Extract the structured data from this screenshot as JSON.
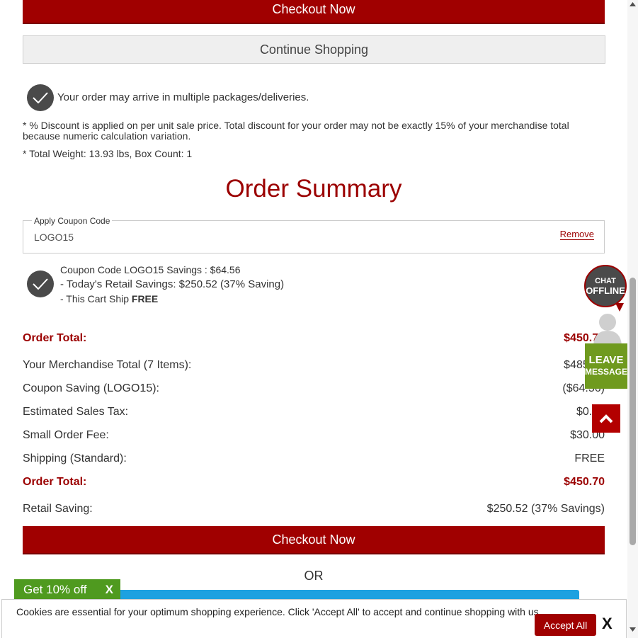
{
  "buttons": {
    "checkout_top": "Checkout Now",
    "continue_shopping": "Continue Shopping",
    "checkout_bottom": "Checkout Now"
  },
  "notices": {
    "packages": "Your order may arrive in multiple packages/deliveries.",
    "discount_note": "* % Discount is applied on per unit sale price. Total discount for your order may not be exactly 15% of your merchandise total because numeric calculation variation.",
    "weight_note": "* Total Weight: 13.93 lbs, Box Count: 1"
  },
  "order_summary": {
    "title": "Order Summary",
    "coupon": {
      "legend": "Apply Coupon Code",
      "value": "LOGO15",
      "remove_label": "Remove"
    },
    "savings": {
      "coupon_line": "Coupon Code LOGO15 Savings : $64.56",
      "retail_line": "- Today's Retail Savings:  $250.52 (37% Saving)",
      "ship_prefix": "- This Cart Ship ",
      "ship_value": "FREE"
    },
    "lines": [
      {
        "label": "Order Total:",
        "value": "$450.70",
        "total": true
      },
      {
        "label": "Your Merchandise Total (7 Items):",
        "value": "$485.26",
        "total": false
      },
      {
        "label": "Coupon Saving (LOGO15):",
        "value": "($64.56)",
        "total": false
      },
      {
        "label": "Estimated Sales Tax:",
        "value": "$0.00",
        "total": false
      },
      {
        "label": "Small Order Fee:",
        "value": "$30.00",
        "total": false
      },
      {
        "label": "Shipping (Standard):",
        "value": "FREE",
        "total": false
      },
      {
        "label": "Order Total:",
        "value": "$450.70",
        "total": true
      },
      {
        "label": "Retail Saving:",
        "value": "$250.52 (37% Savings)",
        "total": false
      }
    ],
    "or_text": "OR"
  },
  "promo": {
    "label": "Get 10% off",
    "close": "X"
  },
  "cookie_bar": {
    "text": "Cookies are essential for your optimum shopping experience. Click 'Accept All' to accept and continue shopping with us.",
    "accept_label": "Accept All",
    "close": "X"
  },
  "chat": {
    "status_line1": "CHAT",
    "status_line2": "OFFLINE",
    "leave_line1": "LEAVE",
    "leave_line2": "MESSAGE"
  },
  "colors": {
    "brand_red": "#a00000",
    "summary_red": "#9b0000",
    "promo_green": "#4f9a1f",
    "chat_green": "#6f9a1e",
    "paypal_blue": "#1da1e0"
  }
}
